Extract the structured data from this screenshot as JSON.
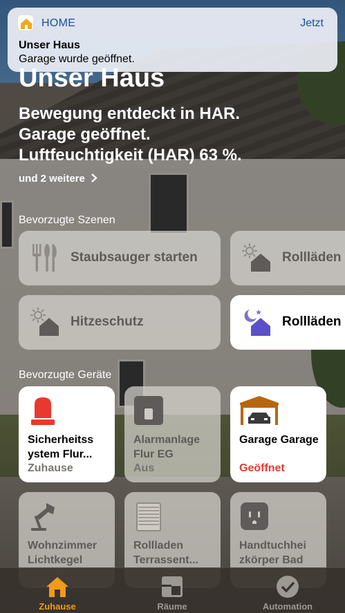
{
  "notification": {
    "app": "HOME",
    "time": "Jetzt",
    "title": "Unser Haus",
    "body": "Garage wurde geöffnet."
  },
  "home": {
    "title": "Unser Haus",
    "status_lines": [
      "Bewegung entdeckt in HAR.",
      "Garage geöffnet.",
      "Luftfeuchtigkeit (HAR) 63 %."
    ],
    "more": "und 2 weitere"
  },
  "scenes": {
    "heading": "Bevorzugte Szenen",
    "items": [
      {
        "label": "Staubsauger starten",
        "icon": "cutlery-icon",
        "active": false
      },
      {
        "label": "Rollläden",
        "icon": "sun-house-icon",
        "active": false
      },
      {
        "label": "Hitzeschutz",
        "icon": "sun-house-icon",
        "active": false
      },
      {
        "label": "Rollläden",
        "icon": "moon-house-icon",
        "active": true
      }
    ]
  },
  "devices": {
    "heading": "Bevorzugte Geräte",
    "items": [
      {
        "name": "Sicherheitss ystem Flur...",
        "status": "Zuhause",
        "icon": "siren-icon",
        "on": true
      },
      {
        "name": "Alarmanlage Flur EG",
        "status": "Aus",
        "icon": "switch-icon",
        "on": false
      },
      {
        "name": "Garage Garage",
        "status": "Geöffnet",
        "icon": "garage-icon",
        "on": true,
        "alert": true
      },
      {
        "name": "Wohnzimmer Lichtkegel",
        "status": "",
        "icon": "lamp-icon",
        "on": false
      },
      {
        "name": "Rollladen Terrassent...",
        "status": "",
        "icon": "blinds-icon",
        "on": false
      },
      {
        "name": "Handtuchhei zkörper Bad",
        "status": "",
        "icon": "outlet-icon",
        "on": false
      }
    ]
  },
  "tabs": [
    {
      "label": "Zuhause",
      "icon": "home-icon",
      "active": true
    },
    {
      "label": "Räume",
      "icon": "rooms-icon",
      "active": false
    },
    {
      "label": "Automation",
      "icon": "clock-check-icon",
      "active": false
    }
  ],
  "colors": {
    "accent": "#f19a1c",
    "alert": "#e8392e",
    "notification_link": "#1a4fa0"
  }
}
